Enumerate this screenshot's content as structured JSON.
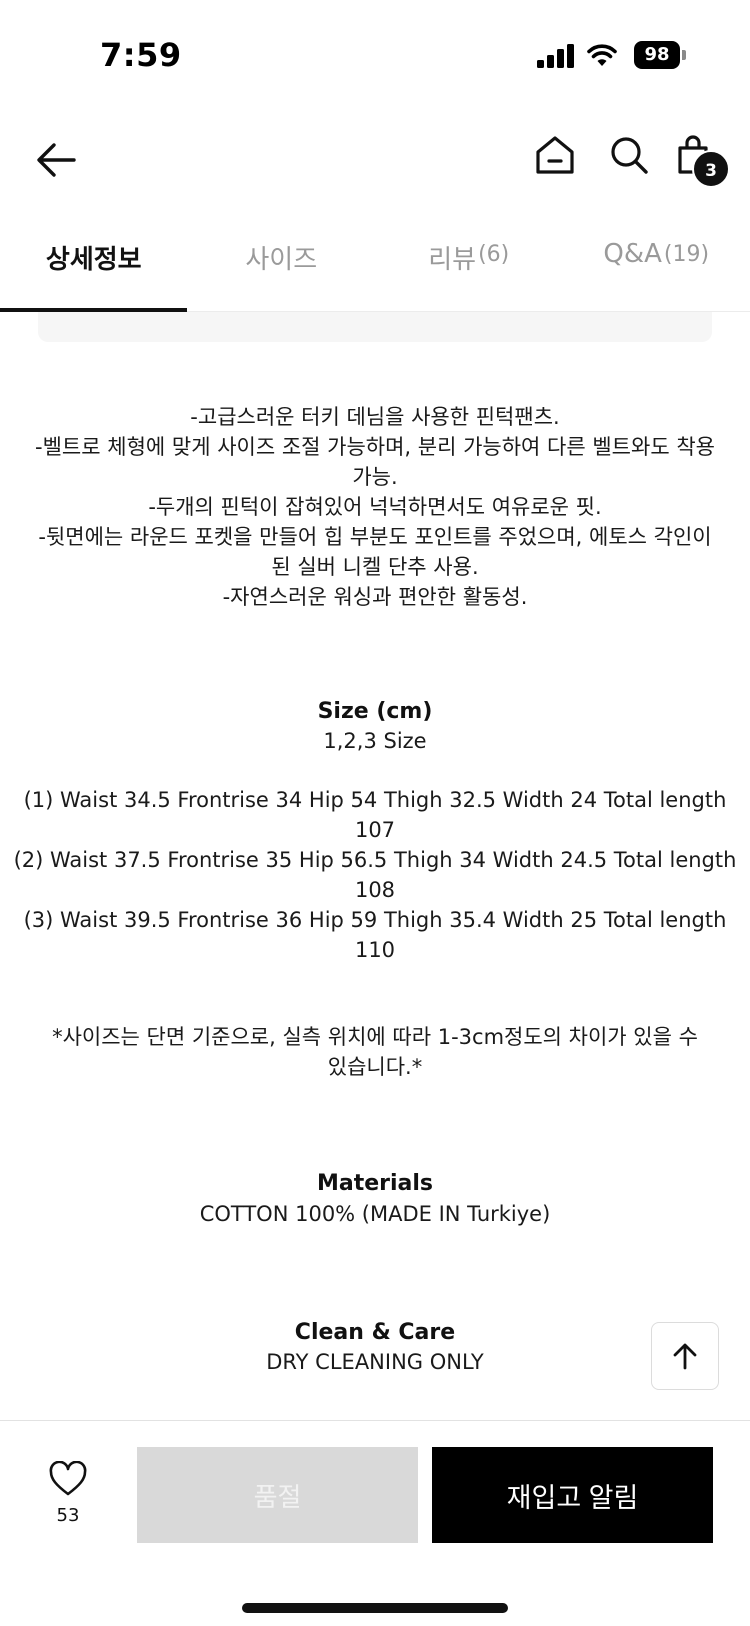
{
  "status": {
    "time": "7:59",
    "battery": "98"
  },
  "header": {
    "cart_count": "3"
  },
  "tabs": [
    {
      "label": "상세정보",
      "count": ""
    },
    {
      "label": "사이즈",
      "count": ""
    },
    {
      "label": "리뷰",
      "count": "(6)"
    },
    {
      "label": "Q&A",
      "count": "(19)"
    }
  ],
  "description": [
    "-고급스러운 터키 데님을 사용한 핀턱팬츠.",
    "-벨트로 체형에 맞게 사이즈 조절 가능하며, 분리 가능하여 다른 벨트와도 착용",
    "가능.",
    "-두개의 핀턱이 잡혀있어 넉넉하면서도 여유로운 핏.",
    "-뒷면에는 라운드 포켓을 만들어 힙 부분도 포인트를 주었으며, 에토스 각인이",
    "된 실버 니켈 단추 사용.",
    "-자연스러운 워싱과 편안한 활동성."
  ],
  "size": {
    "heading": "Size (cm)",
    "sizes_line": "1,2,3 Size",
    "rows": [
      "(1) Waist 34.5  Frontrise 34  Hip 54 Thigh 32.5  Width 24 Total length",
      "107",
      "(2) Waist 37.5   Frontrise 35  Hip 56.5 Thigh 34 Width 24.5 Total length",
      "108",
      "(3) Waist 39.5  Frontrise 36 Hip 59 Thigh 35.4  Width 25 Total length",
      "110"
    ],
    "note": [
      "*사이즈는 단면 기준으로, 실측 위치에 따라 1-3cm정도의 차이가 있을 수",
      "있습니다.*"
    ]
  },
  "materials": {
    "heading": "Materials",
    "value": "COTTON 100% (MADE IN Turkiye)"
  },
  "care": {
    "heading": "Clean & Care",
    "value": "DRY CLEANING ONLY"
  },
  "bottom": {
    "like_count": "53",
    "soldout_label": "품절",
    "restock_label": "재입고 알림"
  }
}
